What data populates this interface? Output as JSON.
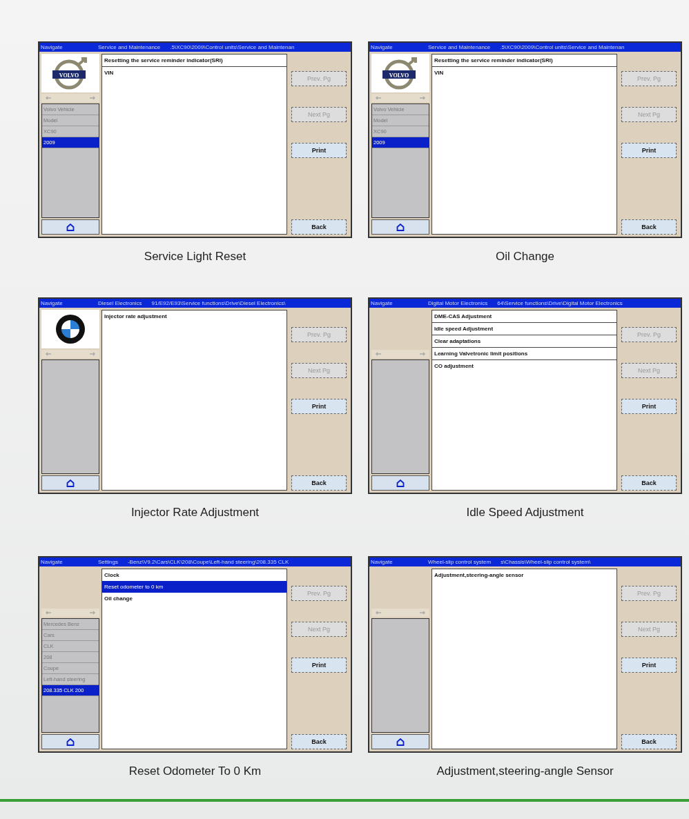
{
  "panels": [
    {
      "title_bar": {
        "menu": "Navigate",
        "section": "Service and Maintenance",
        "path": ".5\\XC90\\2009\\Control units\\Service and Maintenan"
      },
      "logo": {
        "kind": "volvo",
        "text": "VOLVO"
      },
      "sidebar_items": [
        {
          "label": "Volvo Vehicle",
          "selected": false
        },
        {
          "label": "Model",
          "selected": false
        },
        {
          "label": "XC90",
          "selected": false
        },
        {
          "label": "2009",
          "selected": true
        }
      ],
      "items": [
        {
          "label": "Resetting the service reminder indicator(SRI)",
          "boxed": true,
          "selected": false
        },
        {
          "label": "VIN",
          "boxed": false,
          "selected": false
        }
      ],
      "buttons": [
        {
          "label": "Prev. Pg",
          "disabled": true
        },
        {
          "label": "Next Pg",
          "disabled": true
        },
        {
          "label": "Print",
          "disabled": false
        },
        {
          "label": "Back",
          "disabled": false
        }
      ],
      "caption": "Service Light Reset"
    },
    {
      "title_bar": {
        "menu": "Navigate",
        "section": "Service and Maintenance",
        "path": ".5\\XC90\\2009\\Control units\\Service and Maintenan"
      },
      "logo": {
        "kind": "volvo",
        "text": "VOLVO"
      },
      "sidebar_items": [
        {
          "label": "Volvo Vehicle",
          "selected": false
        },
        {
          "label": "Model",
          "selected": false
        },
        {
          "label": "XC90",
          "selected": false
        },
        {
          "label": "2009",
          "selected": true
        }
      ],
      "items": [
        {
          "label": "Resetting the service reminder indicator(SRI)",
          "boxed": true,
          "selected": false
        },
        {
          "label": "VIN",
          "boxed": false,
          "selected": false
        }
      ],
      "buttons": [
        {
          "label": "Prev. Pg",
          "disabled": true
        },
        {
          "label": "Next Pg",
          "disabled": true
        },
        {
          "label": "Print",
          "disabled": false
        },
        {
          "label": "Back",
          "disabled": false
        }
      ],
      "caption": "Oil Change"
    },
    {
      "title_bar": {
        "menu": "Navigate",
        "section": "Diesel Electronics",
        "path": "91/E92/E93\\Service functions\\Drive\\Diesel Electronics\\"
      },
      "logo": {
        "kind": "bmw"
      },
      "items": [
        {
          "label": "Injector rate adjustment",
          "boxed": false,
          "selected": false
        }
      ],
      "buttons": [
        {
          "label": "Prev. Pg",
          "disabled": true
        },
        {
          "label": "Next Pg",
          "disabled": true
        },
        {
          "label": "Print",
          "disabled": false
        },
        {
          "label": "Back",
          "disabled": false
        }
      ],
      "caption": "Injector Rate Adjustment"
    },
    {
      "title_bar": {
        "menu": "Navigate",
        "section": "Digital Motor Electronics",
        "path": "64\\Service functions\\Drive\\Digital Motor Electronics"
      },
      "logo": {
        "kind": "none"
      },
      "items": [
        {
          "label": "DME-CAS Adjustment",
          "boxed": true,
          "selected": false
        },
        {
          "label": "Idle speed Adjustment",
          "boxed": true,
          "selected": false
        },
        {
          "label": "Clear adaptations",
          "boxed": true,
          "selected": false
        },
        {
          "label": "Learning Valvetronic limit positions",
          "boxed": true,
          "selected": false
        },
        {
          "label": "CO adjustment",
          "boxed": false,
          "selected": false
        }
      ],
      "buttons": [
        {
          "label": "Prev. Pg",
          "disabled": true
        },
        {
          "label": "Next Pg",
          "disabled": true
        },
        {
          "label": "Print",
          "disabled": false
        },
        {
          "label": "Back",
          "disabled": false
        }
      ],
      "caption": "Idle Speed Adjustment"
    },
    {
      "title_bar": {
        "menu": "Navigate",
        "section": "Settings",
        "path": "-Benz\\V9.2\\Cars\\CLK\\208\\Coupe\\Left-hand steering\\208.335 CLK"
      },
      "logo": {
        "kind": "none"
      },
      "sidebar_items": [
        {
          "label": "Mercedes Benz",
          "selected": false
        },
        {
          "label": "Cars",
          "selected": false
        },
        {
          "label": "CLK",
          "selected": false
        },
        {
          "label": "208",
          "selected": false
        },
        {
          "label": "Coupe",
          "selected": false
        },
        {
          "label": "Left-hand steering",
          "selected": false
        },
        {
          "label": "208.335  CLK 200",
          "selected": true
        }
      ],
      "items": [
        {
          "label": "Clock",
          "boxed": false,
          "selected": false
        },
        {
          "label": "Reset odometer to 0 km",
          "boxed": false,
          "selected": true
        },
        {
          "label": "Oil change",
          "boxed": false,
          "selected": false
        }
      ],
      "buttons": [
        {
          "label": "Prev. Pg",
          "disabled": true
        },
        {
          "label": "Next Pg",
          "disabled": true
        },
        {
          "label": "Print",
          "disabled": false
        },
        {
          "label": "Back",
          "disabled": false
        }
      ],
      "caption": "Reset Odometer To 0 Km"
    },
    {
      "title_bar": {
        "menu": "Navigate",
        "section": "Wheel-slip control system",
        "path": "s\\Chassis\\Wheel-slip control system\\"
      },
      "logo": {
        "kind": "none"
      },
      "items": [
        {
          "label": "Adjustment,steering-angle sensor",
          "boxed": false,
          "selected": false
        }
      ],
      "buttons": [
        {
          "label": "Prev. Pg",
          "disabled": true
        },
        {
          "label": "Next Pg",
          "disabled": true
        },
        {
          "label": "Print",
          "disabled": false
        },
        {
          "label": "Back",
          "disabled": false
        }
      ],
      "caption": "Adjustment,steering-angle Sensor"
    }
  ]
}
